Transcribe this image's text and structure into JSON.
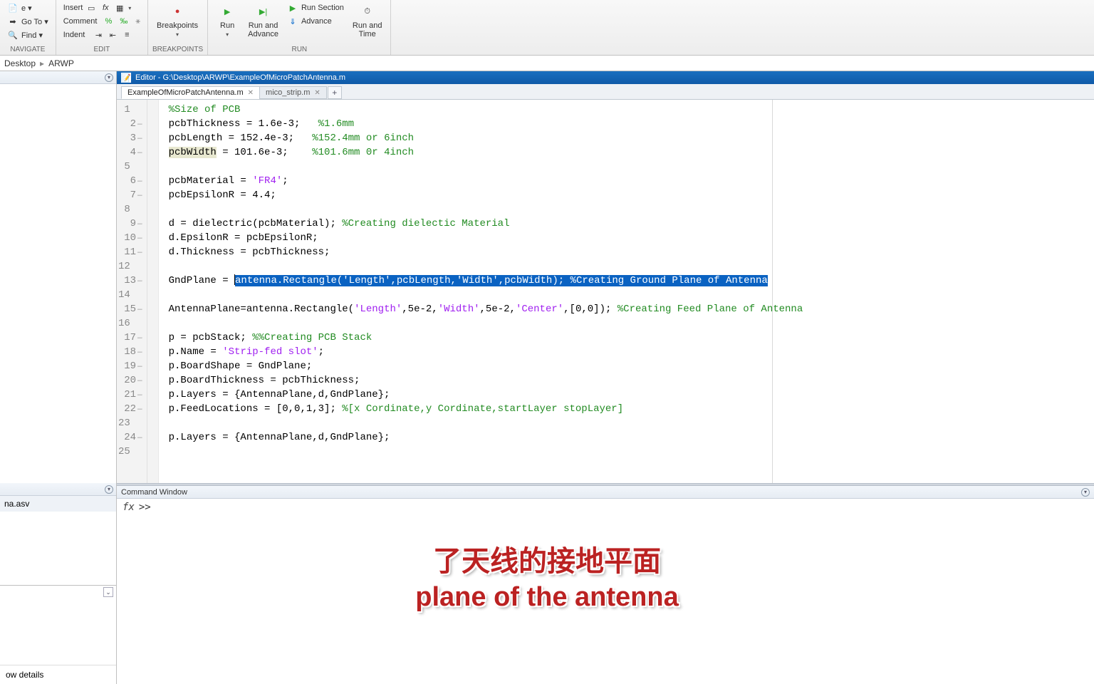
{
  "ribbon": {
    "navigate": {
      "label": "NAVIGATE",
      "compare": "e ▾",
      "goto": "Go To ▾",
      "find": "Find ▾"
    },
    "edit": {
      "label": "EDIT",
      "insert": "Insert",
      "comment": "Comment",
      "indent": "Indent"
    },
    "breakpoints": {
      "label": "BREAKPOINTS",
      "btn": "Breakpoints"
    },
    "run": {
      "label": "RUN",
      "run": "Run",
      "run_advance": "Run and\nAdvance",
      "run_section": "Run Section",
      "advance": "Advance",
      "run_time": "Run and\nTime"
    }
  },
  "breadcrumb": {
    "a": "Desktop",
    "b": "ARWP"
  },
  "left": {
    "item": "na.asv",
    "details": "ow details"
  },
  "editor": {
    "title": "Editor - G:\\Desktop\\ARWP\\ExampleOfMicroPatchAntenna.m",
    "tabs": [
      {
        "name": "ExampleOfMicroPatchAntenna.m",
        "active": true
      },
      {
        "name": "mico_strip.m",
        "active": false
      }
    ]
  },
  "code": {
    "l1_c": "%Size of PCB",
    "l2_a": "pcbThickness = 1.6e-3;   ",
    "l2_c": "%1.6mm",
    "l3_a": "pcbLength = 152.4e-3;   ",
    "l3_c": "%152.4mm or 6inch",
    "l4_hl": "pcbWidth",
    "l4_a": " = 101.6e-3;    ",
    "l4_c": "%101.6mm 0r 4inch",
    "l6_a": "pcbMaterial = ",
    "l6_s": "'FR4'",
    "l6_b": ";",
    "l7": "pcbEpsilonR = 4.4;",
    "l9_a": "d = dielectric(pcbMaterial); ",
    "l9_c": "%Creating dielectic Material",
    "l10": "d.EpsilonR = pcbEpsilonR;",
    "l11": "d.Thickness = pcbThickness;",
    "l13_a": "GndPlane = ",
    "l13_sel_a": "antenna.Rectangle(",
    "l13_sel_s1": "'Length'",
    "l13_sel_b": ",pcbLength,",
    "l13_sel_s2": "'Width'",
    "l13_sel_c": ",pcbWidth); ",
    "l13_sel_cm": "%Creating Ground Plane of Antenna",
    "l15_a": "AntennaPlane=antenna.Rectangle(",
    "l15_s1": "'Length'",
    "l15_b": ",5e-2,",
    "l15_s2": "'Width'",
    "l15_c": ",5e-2,",
    "l15_s3": "'Center'",
    "l15_d": ",[0,0]); ",
    "l15_cm": "%Creating Feed Plane of Antenna",
    "l17_a": "p = pcbStack; ",
    "l17_c": "%%Creating PCB Stack",
    "l18_a": "p.Name = ",
    "l18_s": "'Strip-fed slot'",
    "l18_b": ";",
    "l19": "p.BoardShape = GndPlane;",
    "l20": "p.BoardThickness = pcbThickness;",
    "l21": "p.Layers = {AntennaPlane,d,GndPlane};",
    "l22_a": "p.FeedLocations = [0,0,1,3]; ",
    "l22_c": "%[x Cordinate,y Cordinate,startLayer stopLayer]",
    "l24": "p.Layers = {AntennaPlane,d,GndPlane};"
  },
  "cmd": {
    "title": "Command Window",
    "prompt": ">>"
  },
  "subtitle": {
    "zh": "了天线的接地平面",
    "en": "plane of the antenna"
  }
}
